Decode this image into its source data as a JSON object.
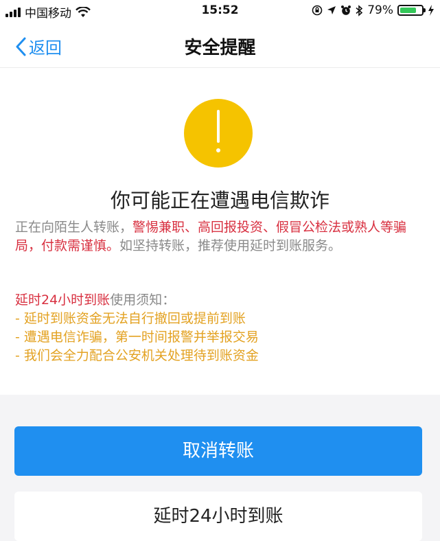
{
  "status_bar": {
    "carrier": "中国移动",
    "time": "15:52",
    "battery_percent": "79%",
    "battery_level": 0.79,
    "icons": [
      "signal-icon",
      "wifi-icon",
      "rotation-lock-icon",
      "location-icon",
      "alarm-icon",
      "bluetooth-icon",
      "battery-icon",
      "charging-icon"
    ]
  },
  "nav": {
    "back_label": "返回",
    "title": "安全提醒"
  },
  "alert": {
    "icon": "exclamation-icon",
    "icon_color": "#f5c300",
    "headline": "你可能正在遭遇电信欺诈",
    "text_prefix": "正在向陌生人转账，",
    "text_emphasis": "警惕兼职、高回报投资、假冒公检法或熟人等骗局，付款需谨慎。",
    "text_suffix": "如坚持转账，推荐使用延时到账服务。"
  },
  "notice": {
    "title_emphasis": "延时24小时到账",
    "title_rest": "使用须知：",
    "items": [
      "- 延时到账资金无法自行撤回或提前到账",
      "- 遭遇电信诈骗，第一时间报警并举报交易",
      "- 我们会全力配合公安机关处理待到账资金"
    ]
  },
  "actions": {
    "cancel_label": "取消转账",
    "delay_label": "延时24小时到账"
  },
  "colors": {
    "accent": "#1f8ff0",
    "warning_red": "#d83040",
    "notice_orange": "#e3a222",
    "icon_yellow": "#f5c300"
  }
}
